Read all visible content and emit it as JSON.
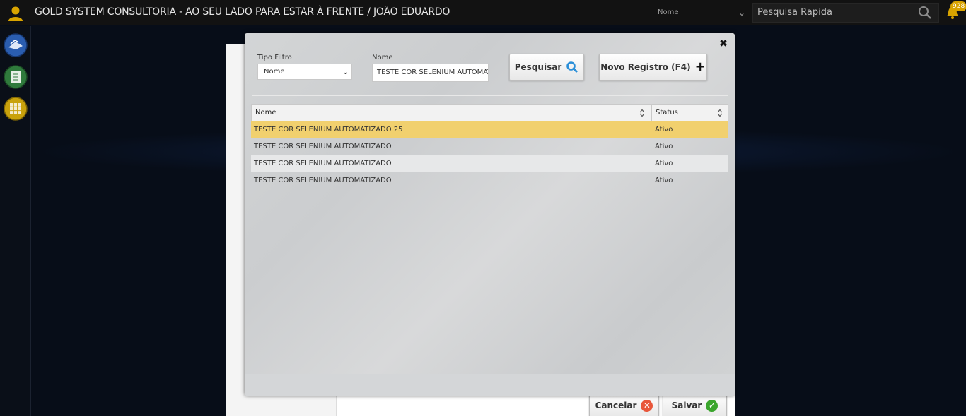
{
  "topbar": {
    "title": "GOLD SYSTEM CONSULTORIA - AO SEU LADO PARA ESTAR À FRENTE / JOÃO EDUARDO",
    "search_field_value": "Nome",
    "quick_search_placeholder": "Pesquisa Rapida",
    "notifications_count": "928"
  },
  "sidebar": {
    "items": [
      {
        "icon": "shipping-icon",
        "color": "#2a5db0"
      },
      {
        "icon": "ledger-icon",
        "color": "#2f7a3c"
      },
      {
        "icon": "calculator-icon",
        "color": "#c9a20c"
      }
    ]
  },
  "dialog": {
    "filter_type_label": "Tipo Filtro",
    "filter_type_value": "Nome",
    "name_label": "Nome",
    "name_value": "TESTE COR SELENIUM AUTOMATIZADO",
    "search_button": "Pesquisar",
    "new_record_button": "Novo Registro (F4)",
    "columns": [
      "Nome",
      "Status"
    ],
    "rows": [
      {
        "name": "TESTE COR SELENIUM AUTOMATIZADO 25",
        "status": "Ativo"
      },
      {
        "name": "TESTE COR SELENIUM AUTOMATIZADO",
        "status": "Ativo"
      },
      {
        "name": "TESTE COR SELENIUM AUTOMATIZADO",
        "status": "Ativo"
      },
      {
        "name": "TESTE COR SELENIUM AUTOMATIZADO",
        "status": "Ativo"
      }
    ]
  },
  "footer": {
    "cancel_button": "Cancelar",
    "save_button": "Salvar"
  },
  "colors": {
    "selected_row": "#f1d06e",
    "cancel_icon": "#e8563a",
    "save_icon": "#3aa52c",
    "search_icon": "#2b8fd8"
  }
}
